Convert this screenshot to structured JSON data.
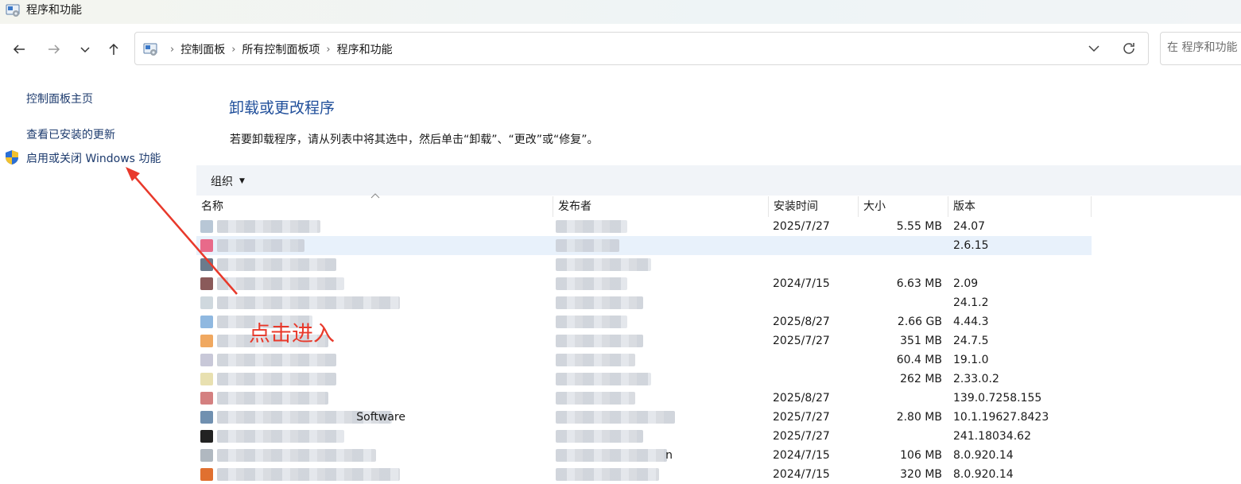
{
  "window": {
    "title": "程序和功能",
    "icon": "control-panel-icon"
  },
  "nav": {
    "back_icon": "back-arrow-icon",
    "forward_icon": "forward-arrow-icon",
    "recent_icon": "chevron-down-icon",
    "up_icon": "up-arrow-icon"
  },
  "address": {
    "crumbs": [
      "控制面板",
      "所有控制面板项",
      "程序和功能"
    ],
    "separator": "›"
  },
  "search": {
    "placeholder": "在 程序和功能"
  },
  "sidebar": {
    "links": [
      "控制面板主页",
      "查看已安装的更新",
      "启用或关闭 Windows 功能"
    ]
  },
  "main": {
    "heading": "卸载或更改程序",
    "instruction": "若要卸载程序，请从列表中将其选中，然后单击“卸载”、“更改”或“修复”。",
    "organize_label": "组织",
    "organize_caret": "▼"
  },
  "table": {
    "columns": [
      "名称",
      "发布者",
      "安装时间",
      "大小",
      "版本"
    ],
    "rows": [
      {
        "name": "",
        "publisher": "",
        "date": "2025/7/27",
        "size": "5.55 MB",
        "version": "24.07",
        "icon_color": "#b8c7d6"
      },
      {
        "name": "",
        "publisher": "",
        "date": "",
        "size": "",
        "version": "2.6.15",
        "icon_color": "#e86a8a",
        "selected": true
      },
      {
        "name": "",
        "publisher": "",
        "date": "",
        "size": "",
        "version": "",
        "icon_color": "#6b7b8c"
      },
      {
        "name": "",
        "publisher": "",
        "date": "2024/7/15",
        "size": "6.63 MB",
        "version": "2.09",
        "icon_color": "#8a5a5a"
      },
      {
        "name": "",
        "publisher": "",
        "date": "",
        "size": "",
        "version": "24.1.2",
        "icon_color": "#cfd8de"
      },
      {
        "name": "",
        "publisher": "",
        "date": "2025/8/27",
        "size": "2.66 GB",
        "version": "4.44.3",
        "icon_color": "#8fb8e0"
      },
      {
        "name": "",
        "publisher": "",
        "date": "2025/7/27",
        "size": "351 MB",
        "version": "24.7.5",
        "icon_color": "#f0a860"
      },
      {
        "name": "",
        "publisher": "",
        "date": "",
        "size": "60.4 MB",
        "version": "19.1.0",
        "icon_color": "#c8c8d8"
      },
      {
        "name": "",
        "publisher": "",
        "date": "",
        "size": "262 MB",
        "version": "2.33.0.2",
        "icon_color": "#e8e0b0"
      },
      {
        "name": "",
        "publisher": "",
        "date": "2025/8/27",
        "size": "",
        "version": "139.0.7258.155",
        "icon_color": "#d48080"
      },
      {
        "name": "Software",
        "publisher": "",
        "date": "2025/7/27",
        "size": "2.80 MB",
        "version": "10.1.19627.8423",
        "icon_color": "#7090b0"
      },
      {
        "name": "",
        "publisher": "",
        "date": "2025/7/27",
        "size": "",
        "version": "241.18034.62",
        "icon_color": "#222222"
      },
      {
        "name": "",
        "publisher": "n",
        "date": "2024/7/15",
        "size": "106 MB",
        "version": "8.0.920.14",
        "icon_color": "#b0b8c0"
      },
      {
        "name": "",
        "publisher": "",
        "date": "2024/7/15",
        "size": "320 MB",
        "version": "8.0.920.14",
        "icon_color": "#e07030"
      }
    ]
  },
  "annotation": {
    "text": "点击进入",
    "color": "#e8392b"
  }
}
